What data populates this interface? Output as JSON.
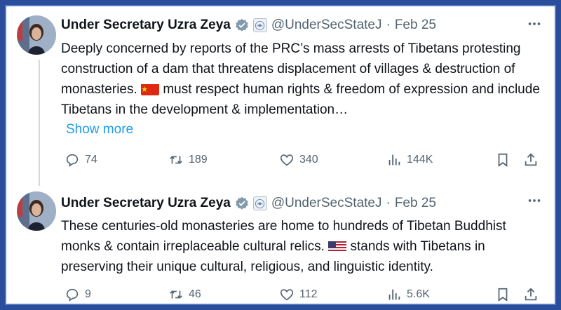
{
  "tweets": [
    {
      "author_name": "Under Secretary Uzra Zeya",
      "handle": "@UnderSecStateJ",
      "separator": "·",
      "date": "Feb 25",
      "text_before_flag": "Deeply concerned by reports of the PRC’s mass arrests of Tibetans protesting construction of a dam that threatens displacement of villages & destruction of monasteries. ",
      "flag": "china-flag",
      "text_after_flag": " must respect human rights & freedom of expression and include Tibetans in the development & implementation…",
      "show_more": "Show more",
      "replies": "74",
      "reposts": "189",
      "likes": "340",
      "views": "144K"
    },
    {
      "author_name": "Under Secretary Uzra Zeya",
      "handle": "@UnderSecStateJ",
      "separator": "·",
      "date": "Feb 25",
      "text_before_flag": "These centuries-old monasteries are home to hundreds of Tibetan Buddhist monks & contain irreplaceable cultural relics. ",
      "flag": "us-flag",
      "text_after_flag": " stands with Tibetans in preserving their unique cultural, religious, and linguistic identity.",
      "replies": "9",
      "reposts": "46",
      "likes": "112",
      "views": "5.6K"
    }
  ],
  "colors": {
    "background_frame": "#2a4d9c",
    "text_primary": "#0f1419",
    "text_secondary": "#536471",
    "link": "#1d9bf0",
    "verified_badge": "#829aab"
  },
  "icons": [
    "more-icon",
    "verified-badge-icon",
    "org-badge-icon",
    "reply-icon",
    "repost-icon",
    "like-icon",
    "views-icon",
    "bookmark-icon",
    "share-icon"
  ]
}
